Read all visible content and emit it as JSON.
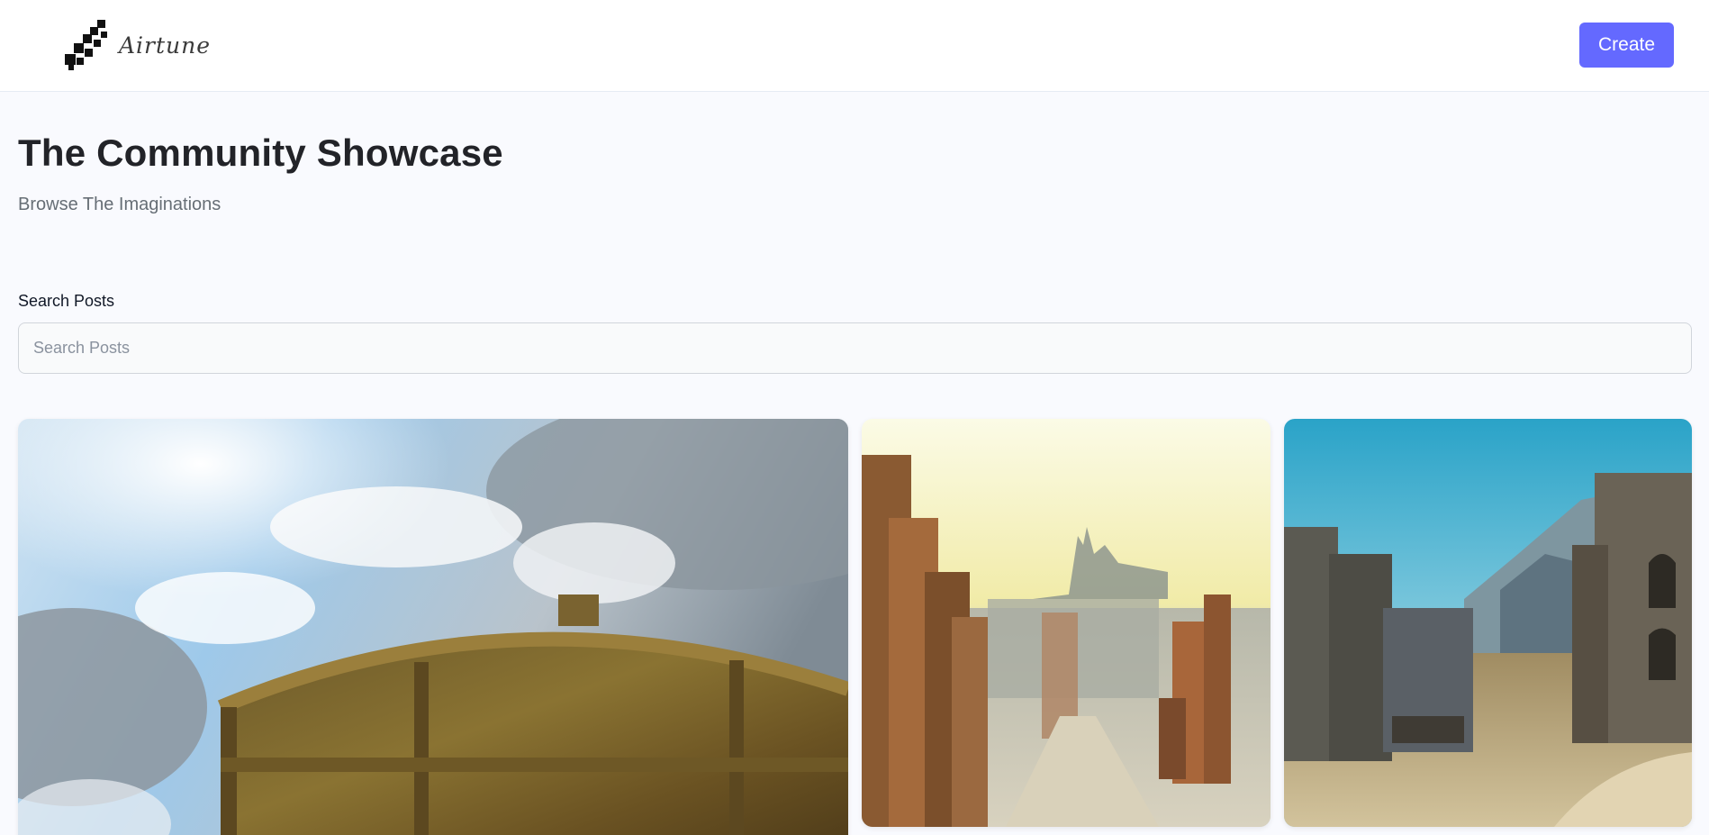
{
  "header": {
    "logo_text": "Airtune",
    "create_label": "Create"
  },
  "hero": {
    "title": "The Community Showcase",
    "subtitle": "Browse The Imaginations"
  },
  "search": {
    "label": "Search Posts",
    "placeholder": "Search Posts",
    "value": ""
  },
  "colors": {
    "accent": "#6469ff",
    "page_background": "#f9fafe",
    "header_background": "#ffffff",
    "title_text": "#222328",
    "subtitle_text": "#666e75"
  },
  "gallery": {
    "posts": [
      {
        "image": "ancient-wooden-door-under-cloudy-sky"
      },
      {
        "image": "ruined-desert-city-skyline"
      },
      {
        "image": "stone-fortress-ruins-blue-sky"
      }
    ]
  }
}
